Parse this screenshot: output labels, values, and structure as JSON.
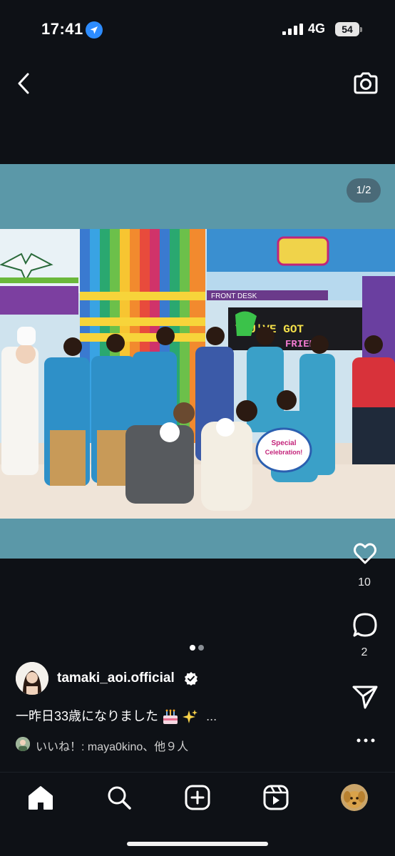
{
  "status_bar": {
    "time": "17:41",
    "network": "4G",
    "battery": "54"
  },
  "story": {
    "page_indicator": "1/2",
    "photo_sign": "FRONT DESK",
    "badge_line1": "Special",
    "badge_line2": "Celebration!",
    "board_text": "YOU'VE GOT A FRIEND IN ME"
  },
  "actions": {
    "like_count": "10",
    "comment_count": "2"
  },
  "post": {
    "username": "tamaki_aoi.official",
    "caption": "一昨日33歳になりました",
    "caption_more": "...",
    "likes_text": "いいね！: maya0kino、他９人"
  },
  "colors": {
    "background": "#0e1116",
    "story_bg": "#5b98a8",
    "verified": "#ffffff"
  },
  "icons": {
    "back": "chevron-left-icon",
    "camera": "camera-icon",
    "like": "heart-icon",
    "comment": "comment-icon",
    "share": "send-icon",
    "more": "more-dots-icon",
    "home": "home-icon",
    "search": "search-icon",
    "create": "plus-square-icon",
    "reels": "reels-icon",
    "profile": "profile-avatar"
  }
}
